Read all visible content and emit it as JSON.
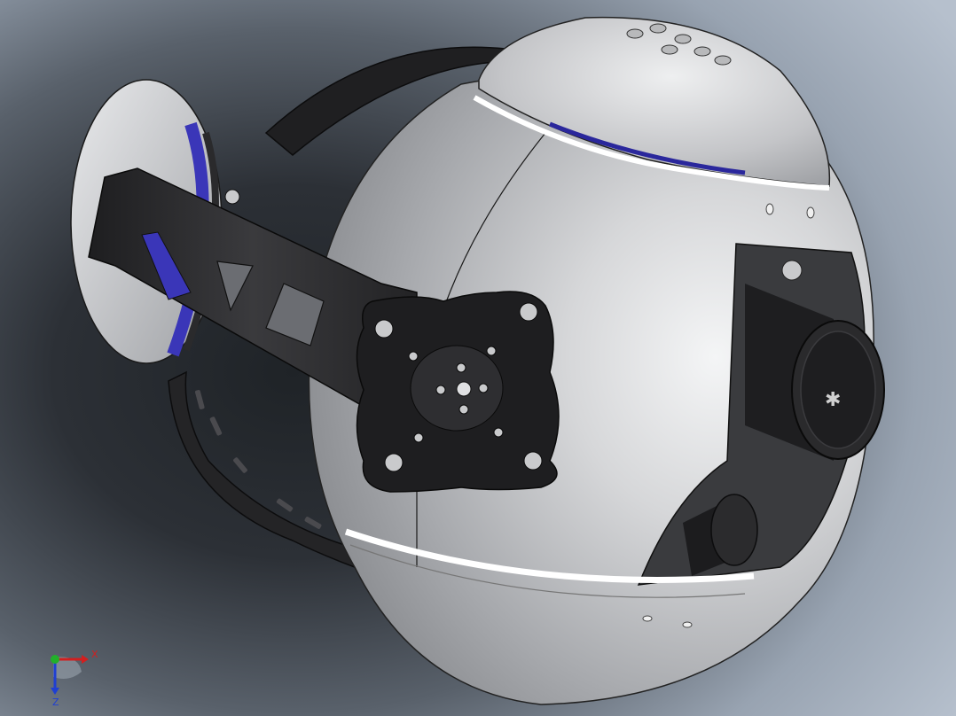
{
  "viewport": {
    "background": {
      "inner": "#1f2327",
      "outer": "#b6c0cd"
    }
  },
  "model": {
    "parts": [
      "sphere-housing",
      "top-cap",
      "bottom-shell",
      "yoke-ring",
      "gimbal-arm",
      "motor-disc",
      "mount-plate",
      "camera-lens",
      "secondary-lens"
    ],
    "colors": {
      "shell": "#c9cacc",
      "arm": "#2a2a2c",
      "accent": "#3a36b8",
      "seam": "#ffffff"
    }
  },
  "triad": {
    "x_label": "X",
    "z_label": "Z",
    "colors": {
      "x": "#d21f1f",
      "y": "#22b02a",
      "z": "#1f3fd2"
    }
  }
}
